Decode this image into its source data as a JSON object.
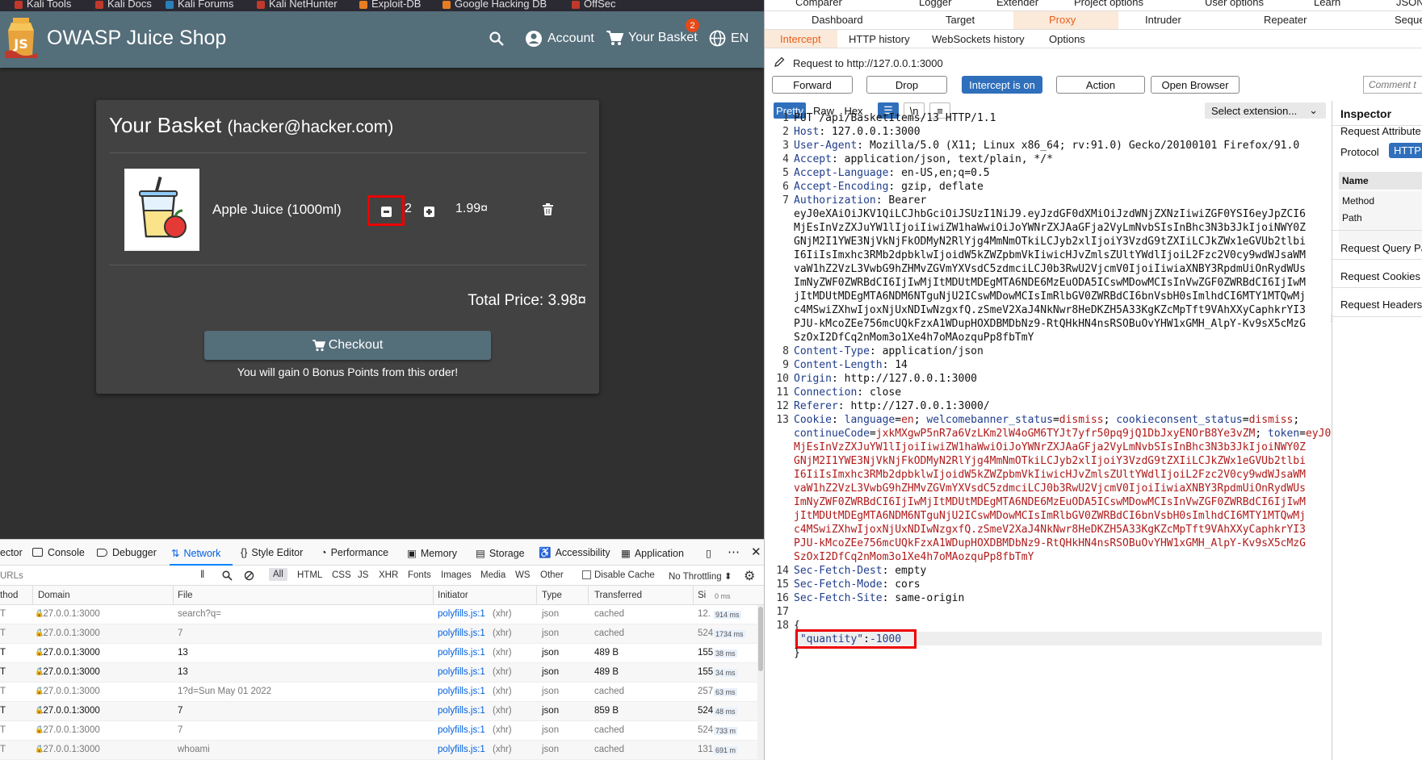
{
  "bookmarks": [
    "Kali Tools",
    "Kali Docs",
    "Kali Forums",
    "Kali NetHunter",
    "Exploit-DB",
    "Google Hacking DB",
    "OffSec"
  ],
  "juiceshop": {
    "title": "OWASP Juice Shop",
    "account_label": "Account",
    "basket_label": "Your Basket",
    "basket_count": "2",
    "lang_label": "EN",
    "basket_heading": "Your Basket",
    "basket_user": "(hacker@hacker.com)",
    "product_name": "Apple Juice (1000ml)",
    "quantity": "2",
    "price": "1.99¤",
    "total": "Total Price: 3.98¤",
    "checkout_label": "Checkout",
    "bonus_text": "You will gain 0 Bonus Points from this order!"
  },
  "devtools": {
    "tabs": [
      "ector",
      "Console",
      "Debugger",
      "Network",
      "Style Editor",
      "Performance",
      "Memory",
      "Storage",
      "Accessibility",
      "Application"
    ],
    "filter_placeholder": "URLs",
    "filters": [
      "All",
      "HTML",
      "CSS",
      "JS",
      "XHR",
      "Fonts",
      "Images",
      "Media",
      "WS",
      "Other"
    ],
    "disable_cache": "Disable Cache",
    "throttling": "No Throttling",
    "columns": [
      "thod",
      "Domain",
      "File",
      "Initiator",
      "Type",
      "Transferred",
      "Si",
      "0 ms"
    ],
    "rows": [
      {
        "method": "T",
        "domain": "127.0.0.1:3000",
        "file": "search?q=",
        "initiator": "polyfills.js:1",
        "init_type": "(xhr)",
        "type": "json",
        "transferred": "cached",
        "size": "12.",
        "time": "914 ms"
      },
      {
        "method": "T",
        "domain": "127.0.0.1:3000",
        "file": "7",
        "initiator": "polyfills.js:1",
        "init_type": "(xhr)",
        "type": "json",
        "transferred": "cached",
        "size": "524",
        "time": "1734 ms"
      },
      {
        "method": "T",
        "domain": "127.0.0.1:3000",
        "file": "13",
        "initiator": "polyfills.js:1",
        "init_type": "(xhr)",
        "type": "json",
        "transferred": "489 B",
        "size": "155",
        "time": "38 ms"
      },
      {
        "method": "T",
        "domain": "127.0.0.1:3000",
        "file": "13",
        "initiator": "polyfills.js:1",
        "init_type": "(xhr)",
        "type": "json",
        "transferred": "489 B",
        "size": "155",
        "time": "34 ms"
      },
      {
        "method": "T",
        "domain": "127.0.0.1:3000",
        "file": "1?d=Sun May 01 2022",
        "initiator": "polyfills.js:1",
        "init_type": "(xhr)",
        "type": "json",
        "transferred": "cached",
        "size": "257",
        "time": "63 ms"
      },
      {
        "method": "T",
        "domain": "127.0.0.1:3000",
        "file": "7",
        "initiator": "polyfills.js:1",
        "init_type": "(xhr)",
        "type": "json",
        "transferred": "859 B",
        "size": "524",
        "time": "48 ms"
      },
      {
        "method": "T",
        "domain": "127.0.0.1:3000",
        "file": "7",
        "initiator": "polyfills.js:1",
        "init_type": "(xhr)",
        "type": "json",
        "transferred": "cached",
        "size": "524",
        "time": "733 m"
      },
      {
        "method": "T",
        "domain": "127.0.0.1:3000",
        "file": "whoami",
        "initiator": "polyfills.js:1",
        "init_type": "(xhr)",
        "type": "json",
        "transferred": "cached",
        "size": "131",
        "time": "691 m"
      }
    ]
  },
  "burp": {
    "top_tabs_row1": [
      "Comparer",
      "Logger",
      "Extender",
      "Project options",
      "User options",
      "Learn",
      "JSON"
    ],
    "top_tabs_row2": [
      "Dashboard",
      "Target",
      "Proxy",
      "Intruder",
      "Repeater",
      "Seque"
    ],
    "sub_tabs": [
      "Intercept",
      "HTTP history",
      "WebSockets history",
      "Options"
    ],
    "request_to": "Request to http://127.0.0.1:3000",
    "buttons": [
      "Forward",
      "Drop",
      "Intercept is on",
      "Action",
      "Open Browser"
    ],
    "comment_placeholder": "Comment t",
    "view_tabs": [
      "Pretty",
      "Raw",
      "Hex"
    ],
    "newline_btn": "\\n",
    "select_extension": "Select extension...",
    "request_lines": [
      {
        "n": "1",
        "t": "PUT /api/BasketItems/13 HTTP/1.1"
      },
      {
        "n": "2",
        "k": "Host",
        "v": "127.0.0.1:3000"
      },
      {
        "n": "3",
        "k": "User-Agent",
        "v": "Mozilla/5.0 (X11; Linux x86_64; rv:91.0) Gecko/20100101 Firefox/91.0"
      },
      {
        "n": "4",
        "k": "Accept",
        "v": "application/json, text/plain, */*"
      },
      {
        "n": "5",
        "k": "Accept-Language",
        "v": "en-US,en;q=0.5"
      },
      {
        "n": "6",
        "k": "Accept-Encoding",
        "v": "gzip, deflate"
      },
      {
        "n": "7",
        "k": "Authorization",
        "v": "Bearer"
      },
      {
        "n": "",
        "t": "eyJ0eXAiOiJKV1QiLCJhbGciOiJSUzI1NiJ9.eyJzdGF0dXMiOiJzdWNjZXNzIiwiZGF0YSI6eyJpZCI6"
      },
      {
        "n": "",
        "t": "MjEsInVzZXJuYW1lIjoiIiwiZW1haWwiOiJoYWNrZXJAaGFja2VyLmNvbSIsInBhc3N3b3JkIjoiNWY0Z"
      },
      {
        "n": "",
        "t": "GNjM2I1YWE3NjVkNjFkODMyN2RlYjg4MmNmOTkiLCJyb2xlIjoiY3VzdG9tZXIiLCJkZWx1eGVUb2tlbi"
      },
      {
        "n": "",
        "t": "I6IiIsImxhc3RMb2dpbklwIjoidW5kZWZpbmVkIiwicHJvZmlsZUltYWdlIjoiL2Fzc2V0cy9wdWJsaWM"
      },
      {
        "n": "",
        "t": "vaW1hZ2VzL3VwbG9hZHMvZGVmYXVsdC5zdmciLCJ0b3RwU2VjcmV0IjoiIiwiaXNBY3RpdmUiOnRydWUs"
      },
      {
        "n": "",
        "t": "ImNyZWF0ZWRBdCI6IjIwMjItMDUtMDEgMTA6NDE6MzEuODA5ICswMDowMCIsInVwZGF0ZWRBdCI6IjIwM"
      },
      {
        "n": "",
        "t": "jItMDUtMDEgMTA6NDM6NTguNjU2ICswMDowMCIsImRlbGV0ZWRBdCI6bnVsbH0sImlhdCI6MTY1MTQwMj"
      },
      {
        "n": "",
        "t": "c4MSwiZXhwIjoxNjUxNDIwNzgxfQ.zSmeV2XaJ4NkNwr8HeDKZH5A33KgKZcMpTft9VAhXXyCaphkrYI3"
      },
      {
        "n": "",
        "t": "PJU-kMcoZEe756mcUQkFzxA1WDupHOXDBMDbNz9-RtQHkHN4nsRSOBuOvYHW1xGMH_AlpY-Kv9sX5cMzG"
      },
      {
        "n": "",
        "t": "SzOxI2DfCq2nMom3o1Xe4h7oMAozquPp8fbTmY"
      },
      {
        "n": "8",
        "k": "Content-Type",
        "v": "application/json"
      },
      {
        "n": "9",
        "k": "Content-Length",
        "v": "14"
      },
      {
        "n": "10",
        "k": "Origin",
        "v": "http://127.0.0.1:3000"
      },
      {
        "n": "11",
        "k": "Connection",
        "v": "close"
      },
      {
        "n": "12",
        "k": "Referer",
        "v": "http://127.0.0.1:3000/"
      }
    ],
    "cookie_line": {
      "n": "13",
      "k": "Cookie",
      "parts": [
        [
          "language",
          "en"
        ],
        [
          "welcomebanner_status",
          "dismiss"
        ],
        [
          "cookieconsent_status",
          "dismiss"
        ]
      ]
    },
    "cookie_cont": [
      {
        "k": "continueCode",
        "v": "jxkMXgwP5nR7a6VzLKm2lW4oGM6TYJt7yfr50pq9jQ1DbJxyENOrB8Ye3vZM"
      },
      {
        "k": "token",
        "v": "eyJ0eXAiOiJKV1QiLCJhbGciOiJSUzI1NiJ9.eyJzdGF0dXMiOiJzdWNjZXNzIiwiZGF0YSI6eyJpZCI6"
      }
    ],
    "token_lines": [
      "MjEsInVzZXJuYW1lIjoiIiwiZW1haWwiOiJoYWNrZXJAaGFja2VyLmNvbSIsInBhc3N3b3JkIjoiNWY0Z",
      "GNjM2I1YWE3NjVkNjFkODMyN2RlYjg4MmNmOTkiLCJyb2xlIjoiY3VzdG9tZXIiLCJkZWx1eGVUb2tlbi",
      "I6IiIsImxhc3RMb2dpbklwIjoidW5kZWZpbmVkIiwicHJvZmlsZUltYWdlIjoiL2Fzc2V0cy9wdWJsaWM",
      "vaW1hZ2VzL3VwbG9hZHMvZGVmYXVsdC5zdmciLCJ0b3RwU2VjcmV0IjoiIiwiaXNBY3RpdmUiOnRydWUs",
      "ImNyZWF0ZWRBdCI6IjIwMjItMDUtMDEgMTA6NDE6MzEuODA5ICswMDowMCIsInVwZGF0ZWRBdCI6IjIwM",
      "jItMDUtMDEgMTA6NDM6NTguNjU2ICswMDowMCIsImRlbGV0ZWRBdCI6bnVsbH0sImlhdCI6MTY1MTQwMj",
      "c4MSwiZXhwIjoxNjUxNDIwNzgxfQ.zSmeV2XaJ4NkNwr8HeDKZH5A33KgKZcMpTft9VAhXXyCaphkrYI3",
      "PJU-kMcoZEe756mcUQkFzxA1WDupHOXDBMDbNz9-RtQHkHN4nsRSOBuOvYHW1xGMH_AlpY-Kv9sX5cMzG",
      "SzOxI2DfCq2nMom3o1Xe4h7oMAozquPp8fbTmY"
    ],
    "tail_lines": [
      {
        "n": "14",
        "k": "Sec-Fetch-Dest",
        "v": "empty"
      },
      {
        "n": "15",
        "k": "Sec-Fetch-Mode",
        "v": "cors"
      },
      {
        "n": "16",
        "k": "Sec-Fetch-Site",
        "v": "same-origin"
      },
      {
        "n": "17",
        "t": ""
      },
      {
        "n": "18",
        "t": "{"
      }
    ],
    "json_key": "\"quantity\"",
    "json_value": "-1000",
    "json_close": "}",
    "inspector": {
      "title": "Inspector",
      "request_attributes": "Request Attribute",
      "protocol": "Protocol",
      "protocol_value": "HTTP",
      "name_col": "Name",
      "method": "Method",
      "path": "Path",
      "query": "Request Query Pa",
      "cookies": "Request Cookies",
      "headers": "Request Headers"
    }
  }
}
